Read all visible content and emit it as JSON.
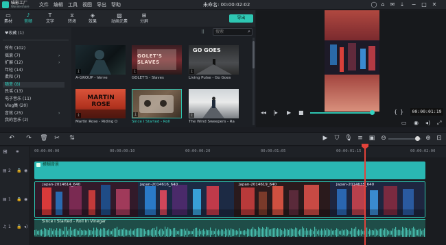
{
  "app": {
    "logo_text": "喵影工厂",
    "logo_sub": "Wondershare",
    "project_title": "未命名: 00:00:02:02"
  },
  "menu": [
    "文件",
    "编辑",
    "工具",
    "视图",
    "导出",
    "帮助"
  ],
  "tabs": [
    {
      "label": "素材",
      "icon": "folder-icon"
    },
    {
      "label": "音频",
      "icon": "music-note-icon"
    },
    {
      "label": "文字",
      "icon": "text-icon"
    },
    {
      "label": "转场",
      "icon": "transition-icon"
    },
    {
      "label": "效果",
      "icon": "effects-icon"
    },
    {
      "label": "动画元素",
      "icon": "image-icon"
    },
    {
      "label": "分屏",
      "icon": "split-screen-icon"
    }
  ],
  "active_tab": "音频",
  "export_label": "导出",
  "favorites": "♥收藏 (1)",
  "categories": [
    {
      "label": "所有 (102)",
      "arrow": false
    },
    {
      "label": "摇滚 (7)",
      "arrow": true
    },
    {
      "label": "扩展 (12)",
      "arrow": true
    },
    {
      "label": "年轻 (14)",
      "arrow": false
    },
    {
      "label": "柔和 (7)",
      "arrow": false
    },
    {
      "label": "随意 (8)",
      "arrow": false,
      "selected": true
    },
    {
      "label": "民谣 (13)",
      "arrow": false
    },
    {
      "label": "电子音乐 (11)",
      "arrow": false
    },
    {
      "label": "Vlog集 (20)",
      "arrow": false
    },
    {
      "label": "音效 (25)",
      "arrow": true
    },
    {
      "label": "我的音乐 (2)",
      "arrow": false
    }
  ],
  "search": {
    "placeholder": "搜索"
  },
  "media": [
    {
      "label": "A-GROUP - Verve",
      "selected": false
    },
    {
      "label": "GOLET'S - Slaves",
      "selected": false
    },
    {
      "label": "Living Pulse - Go Goes",
      "selected": false
    },
    {
      "label": "Martin Rose - Riding O",
      "selected": false
    },
    {
      "label": "Since I Started - Roll",
      "selected": true
    },
    {
      "label": "The Wind Sweepers - Ra",
      "selected": false
    }
  ],
  "media_overlay_text": {
    "m2": "GOLET'S SLAVES",
    "m3": "GO GOES",
    "m4": "MARTIN ROSE"
  },
  "preview": {
    "time": "00:00:01:19",
    "progress": 0.96
  },
  "timeline": {
    "ruler": [
      "00:00:00:00",
      "00:00:00:10",
      "00:00:00:20",
      "00:00:01:05",
      "00:00:01:15",
      "00:00:02:00"
    ],
    "tracks": [
      {
        "id": "2",
        "clip": "模糊背景"
      },
      {
        "id": "1",
        "clips": [
          "Japan-2014614_640",
          "Japan-2014616_640",
          "Japan-2014619_640",
          "Japan-2014635_640"
        ]
      },
      {
        "id": "1",
        "clip": "Since I Started - Roll In Vinegar"
      }
    ],
    "zoom": 0.8
  },
  "colors": {
    "accent": "#2ec7b3",
    "playhead": "#e2423a"
  }
}
